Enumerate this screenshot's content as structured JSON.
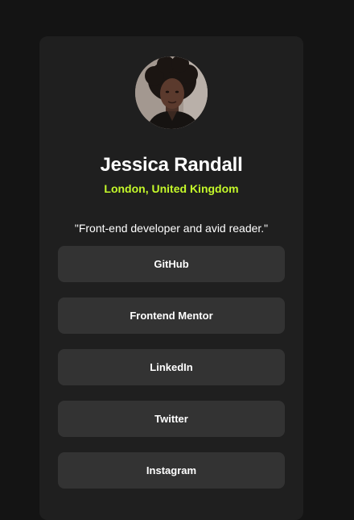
{
  "profile": {
    "name": "Jessica Randall",
    "location": "London, United Kingdom",
    "bio": "\"Front-end developer and avid reader.\""
  },
  "links": [
    {
      "label": "GitHub"
    },
    {
      "label": "Frontend Mentor"
    },
    {
      "label": "LinkedIn"
    },
    {
      "label": "Twitter"
    },
    {
      "label": "Instagram"
    }
  ],
  "colors": {
    "page_background": "#141414",
    "card_background": "#1f1f1f",
    "button_background": "#333333",
    "accent": "#c4f82a",
    "text": "#ffffff"
  }
}
